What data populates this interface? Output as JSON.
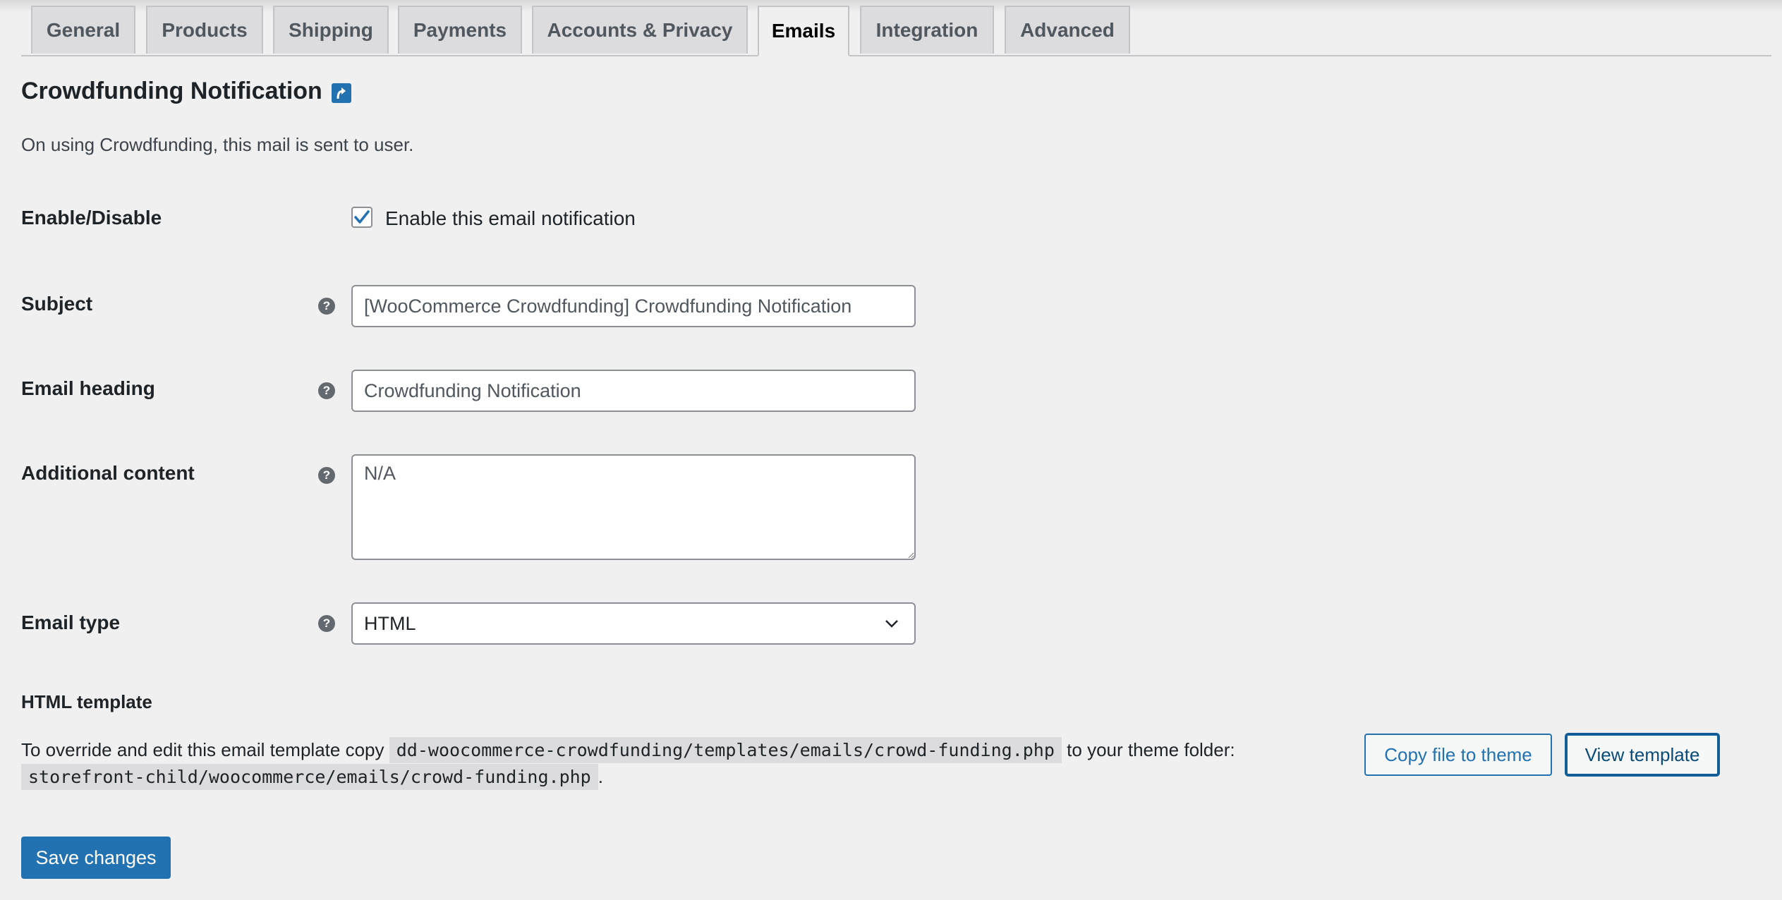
{
  "tabs": [
    {
      "label": "General"
    },
    {
      "label": "Products"
    },
    {
      "label": "Shipping"
    },
    {
      "label": "Payments"
    },
    {
      "label": "Accounts & Privacy"
    },
    {
      "label": "Emails",
      "active": true
    },
    {
      "label": "Integration"
    },
    {
      "label": "Advanced"
    }
  ],
  "heading": {
    "title": "Crowdfunding Notification",
    "link_icon": "up-arrow-link-icon",
    "description": "On using Crowdfunding, this mail is sent to user."
  },
  "form": {
    "enable": {
      "label": "Enable/Disable",
      "checkbox_label": "Enable this email notification",
      "checked": true
    },
    "subject": {
      "label": "Subject",
      "value": "[WooCommerce Crowdfunding] Crowdfunding Notification"
    },
    "email_heading": {
      "label": "Email heading",
      "value": "Crowdfunding Notification"
    },
    "additional_content": {
      "label": "Additional content",
      "value": "N/A"
    },
    "email_type": {
      "label": "Email type",
      "value": "HTML"
    }
  },
  "template": {
    "title": "HTML template",
    "text_before": "To override and edit this email template copy",
    "source_path": "dd-woocommerce-crowdfunding/templates/emails/crowd-funding.php",
    "text_middle": "to your theme folder:",
    "theme_path": "storefront-child/woocommerce/emails/crowd-funding.php",
    "text_after": ".",
    "copy_button": "Copy file to theme",
    "view_button": "View template"
  },
  "save_button": "Save changes",
  "colors": {
    "accent": "#2271b1",
    "background": "#f0f0f1"
  }
}
